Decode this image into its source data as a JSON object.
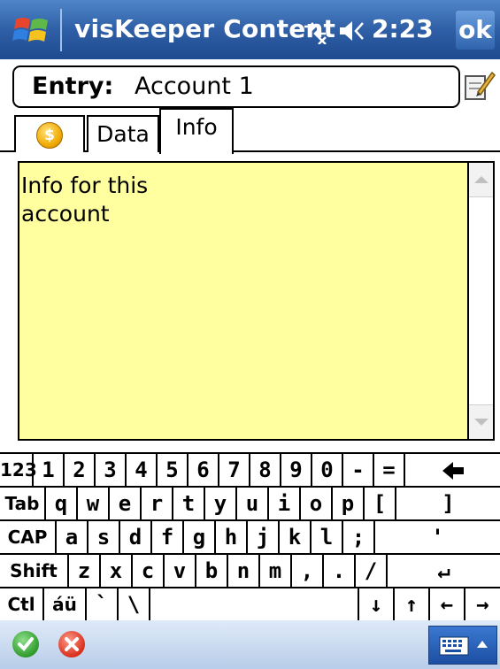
{
  "titlebar": {
    "title": "visKeeper Content",
    "time": "2:23",
    "ok_label": "ok",
    "icons": [
      "windows-start-icon",
      "connectivity-icon",
      "volume-icon"
    ]
  },
  "entry": {
    "label": "Entry:",
    "value": "Account 1"
  },
  "tabs": [
    {
      "label": "",
      "icon": "coin-icon",
      "icon_glyph": "$"
    },
    {
      "label": "Data"
    },
    {
      "label": "Info",
      "selected": true
    }
  ],
  "info_text": {
    "line1": "Info for this",
    "line2": "account",
    "background": "#ffff9f"
  },
  "keyboard": {
    "rows": [
      [
        "123",
        "1",
        "2",
        "3",
        "4",
        "5",
        "6",
        "7",
        "8",
        "9",
        "0",
        "-",
        "=",
        "◆"
      ],
      [
        "Tab",
        "q",
        "w",
        "e",
        "r",
        "t",
        "y",
        "u",
        "i",
        "o",
        "p",
        "[",
        "]"
      ],
      [
        "CAP",
        "a",
        "s",
        "d",
        "f",
        "g",
        "h",
        "j",
        "k",
        "l",
        ";",
        "'"
      ],
      [
        "Shift",
        "z",
        "x",
        "c",
        "v",
        "b",
        "n",
        "m",
        ",",
        ".",
        "/",
        "↵"
      ],
      [
        "Ctl",
        "áü",
        "`",
        "\\",
        "",
        "↓",
        "↑",
        "←",
        "→"
      ]
    ]
  },
  "colors": {
    "titlebar": "#2f5fa6",
    "accent": "#1b4fa3"
  }
}
